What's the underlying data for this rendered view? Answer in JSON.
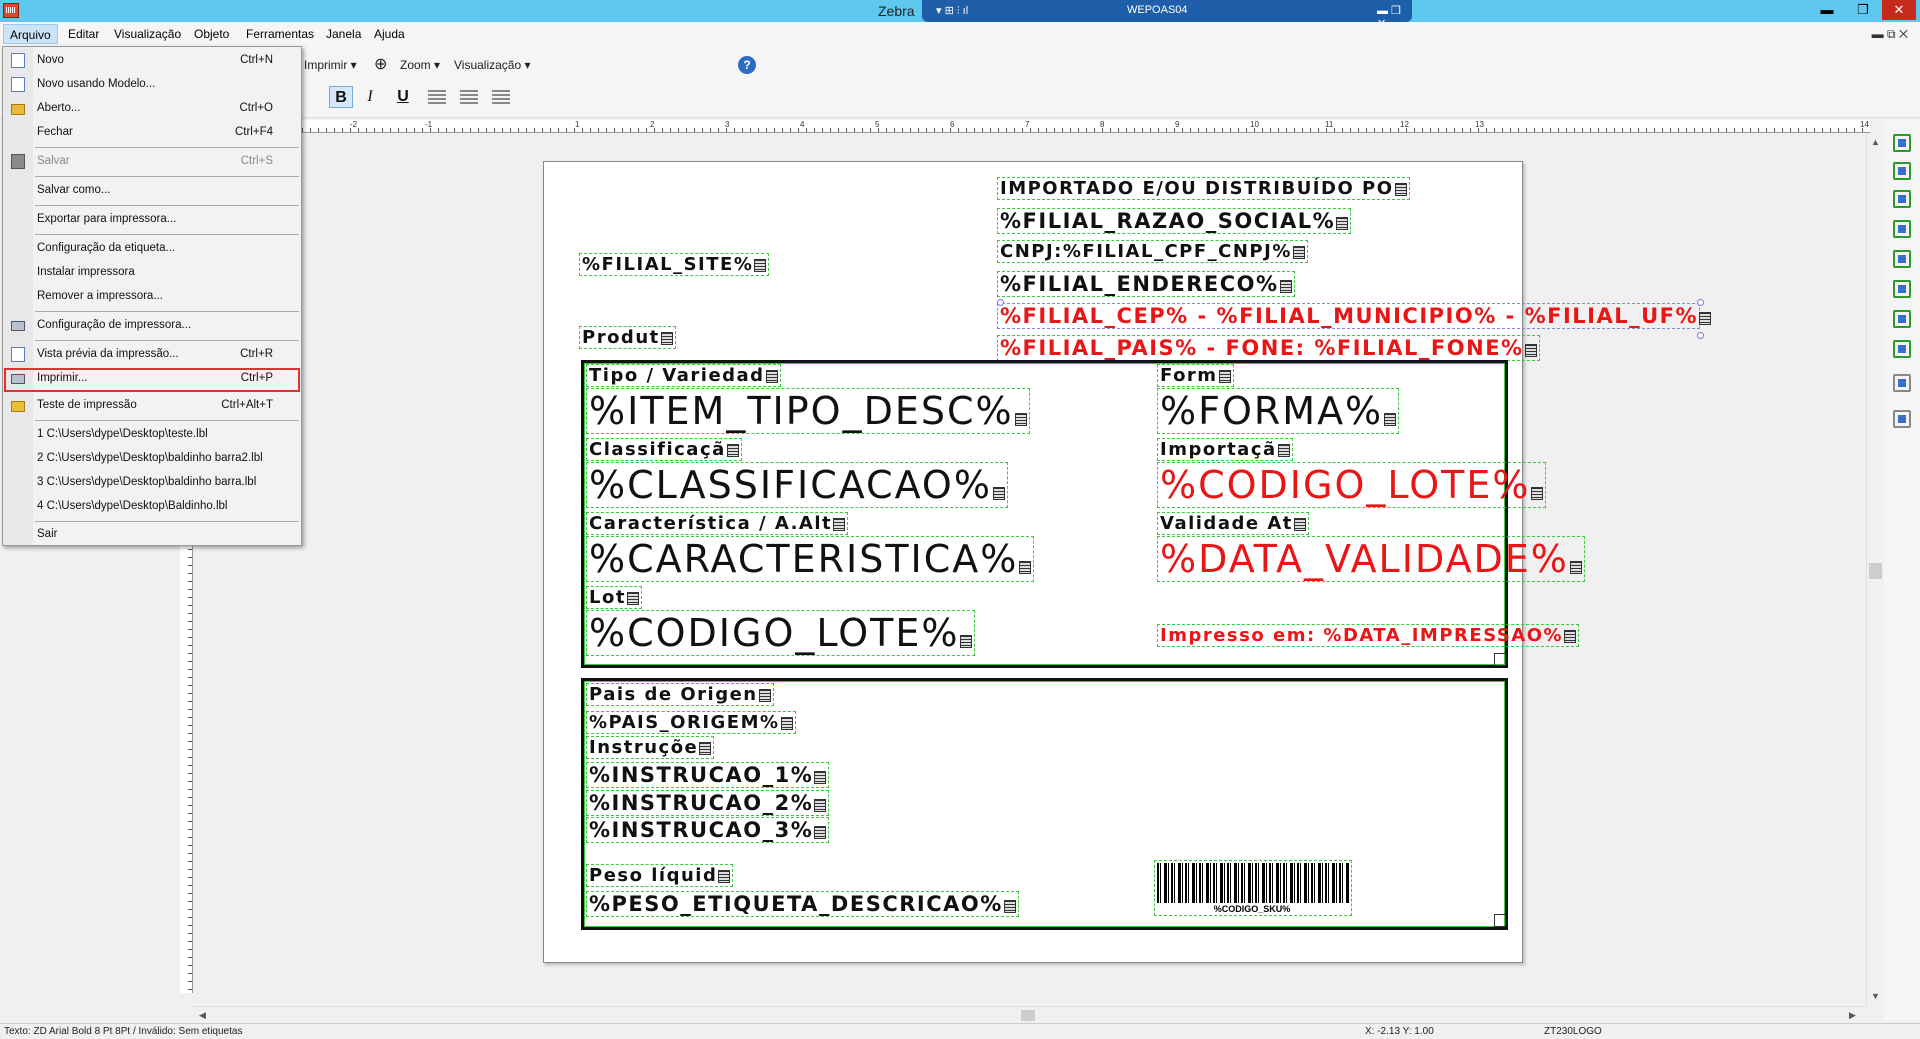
{
  "window": {
    "title": "Zebra",
    "remote_host": "WEPOAS04",
    "controls": {
      "minimize": "▬",
      "restore": "❐",
      "close": "✕"
    }
  },
  "menubar": {
    "items": [
      "Arquivo",
      "Editar",
      "Visualização",
      "Objeto",
      "Ferramentas",
      "Janela",
      "Ajuda"
    ],
    "mdi_controls": "▬   ⧉   ✕"
  },
  "toolbar": {
    "print_label": "Imprimir",
    "zoom_label": "Zoom",
    "view_label": "Visualização",
    "bold": "B",
    "italic": "I",
    "underline": "U",
    "help": "?"
  },
  "ruler": {
    "top_ticks": [
      "-2",
      "-1",
      "1",
      "2",
      "3",
      "4",
      "5",
      "6",
      "7",
      "8",
      "9",
      "10",
      "11",
      "12",
      "13",
      "14"
    ]
  },
  "file_menu": {
    "items": [
      {
        "label": "Novo",
        "shortcut": "Ctrl+N",
        "icon": "new-doc-icon"
      },
      {
        "label": "Novo usando Modelo...",
        "shortcut": "",
        "icon": "template-icon"
      },
      {
        "label": "Aberto...",
        "shortcut": "Ctrl+O",
        "icon": "open-folder-icon"
      },
      {
        "label": "Fechar",
        "shortcut": "Ctrl+F4",
        "icon": ""
      },
      {
        "label": "Salvar",
        "shortcut": "Ctrl+S",
        "icon": "save-icon",
        "disabled": true
      },
      {
        "label": "Salvar como...",
        "shortcut": "",
        "icon": ""
      },
      {
        "label": "Exportar para impressora...",
        "shortcut": "",
        "icon": ""
      },
      {
        "label": "Configuração da etiqueta...",
        "shortcut": "",
        "icon": ""
      },
      {
        "label": "Instalar impressora",
        "shortcut": "",
        "icon": ""
      },
      {
        "label": "Remover a impressora...",
        "shortcut": "",
        "icon": ""
      },
      {
        "label": "Configuração de impressora...",
        "shortcut": "",
        "icon": "printer-setup-icon"
      },
      {
        "label": "Vista prévia da impressão...",
        "shortcut": "Ctrl+R",
        "icon": "preview-icon"
      },
      {
        "label": "Imprimir...",
        "shortcut": "Ctrl+P",
        "icon": "printer-icon"
      },
      {
        "label": "Teste de impressão",
        "shortcut": "Ctrl+Alt+T",
        "icon": "test-print-icon"
      },
      {
        "label": "1 C:\\Users\\dype\\Desktop\\teste.lbl",
        "shortcut": "",
        "icon": ""
      },
      {
        "label": "2 C:\\Users\\dype\\Desktop\\baldinho barra2.lbl",
        "shortcut": "",
        "icon": ""
      },
      {
        "label": "3 C:\\Users\\dype\\Desktop\\baldinho barra.lbl",
        "shortcut": "",
        "icon": ""
      },
      {
        "label": "4 C:\\Users\\dype\\Desktop\\Baldinho.lbl",
        "shortcut": "",
        "icon": ""
      },
      {
        "label": "Sair",
        "shortcut": "",
        "icon": ""
      }
    ]
  },
  "label": {
    "importado": "IMPORTADO E/OU DISTRIBUÍDO PO",
    "filial_razao": "%FILIAL_RAZAO_SOCIAL%",
    "cnpj": "CNPJ:%FILIAL_CPF_CNPJ%",
    "filial_endereco": "%FILIAL_ENDERECO%",
    "filial_cep": "%FILIAL_CEP% - %FILIAL_MUNICIPIO% - %FILIAL_UF%",
    "filial_pais": "%FILIAL_PAIS% - FONE: %FILIAL_FONE%",
    "filial_site": "%FILIAL_SITE%",
    "produto": "Produt",
    "tipo_lbl": "Tipo / Variedad",
    "tipo_val": "%ITEM_TIPO_DESC%",
    "forma_lbl": "Form",
    "forma_val": "%FORMA%",
    "classif_lbl": "Classificaçã",
    "classif_val": "%CLASSIFICACAO%",
    "import_lbl": "Importaçã",
    "import_val": "%CODIGO_LOTE%",
    "caract_lbl": "Característica / A.Alt",
    "caract_val": "%CARACTERISTICA%",
    "validade_lbl": "Validade At",
    "validade_val": "%DATA_VALIDADE%",
    "lote_lbl": "Lot",
    "lote_val": "%CODIGO_LOTE%",
    "impresso": "Impresso em: %DATA_IMPRESSAO%",
    "pais_lbl": "Pais de Origen",
    "pais_val": "%PAIS_ORIGEM%",
    "instr_lbl": "Instruçõe",
    "instr1": "%INSTRUCAO_1%",
    "instr2": "%INSTRUCAO_2%",
    "instr3": "%INSTRUCAO_3%",
    "peso_lbl": "Peso líquid",
    "peso_val": "%PESO_ETIQUETA_DESCRICAO%",
    "barcode_text": "%CODIGO_SKU%"
  },
  "statusbar": {
    "text": "Texto: ZD Arial Bold 8 Pt 8Pt  / Inválido: Sem etiquetas",
    "coords": "X: -2.13 Y:  1.00",
    "printer": "ZT230LOGO"
  },
  "colors": {
    "titlebar": "#5fc8ee",
    "field_red": "#e81616",
    "field_border": "#3ec83e",
    "highlight": "#e03030"
  }
}
